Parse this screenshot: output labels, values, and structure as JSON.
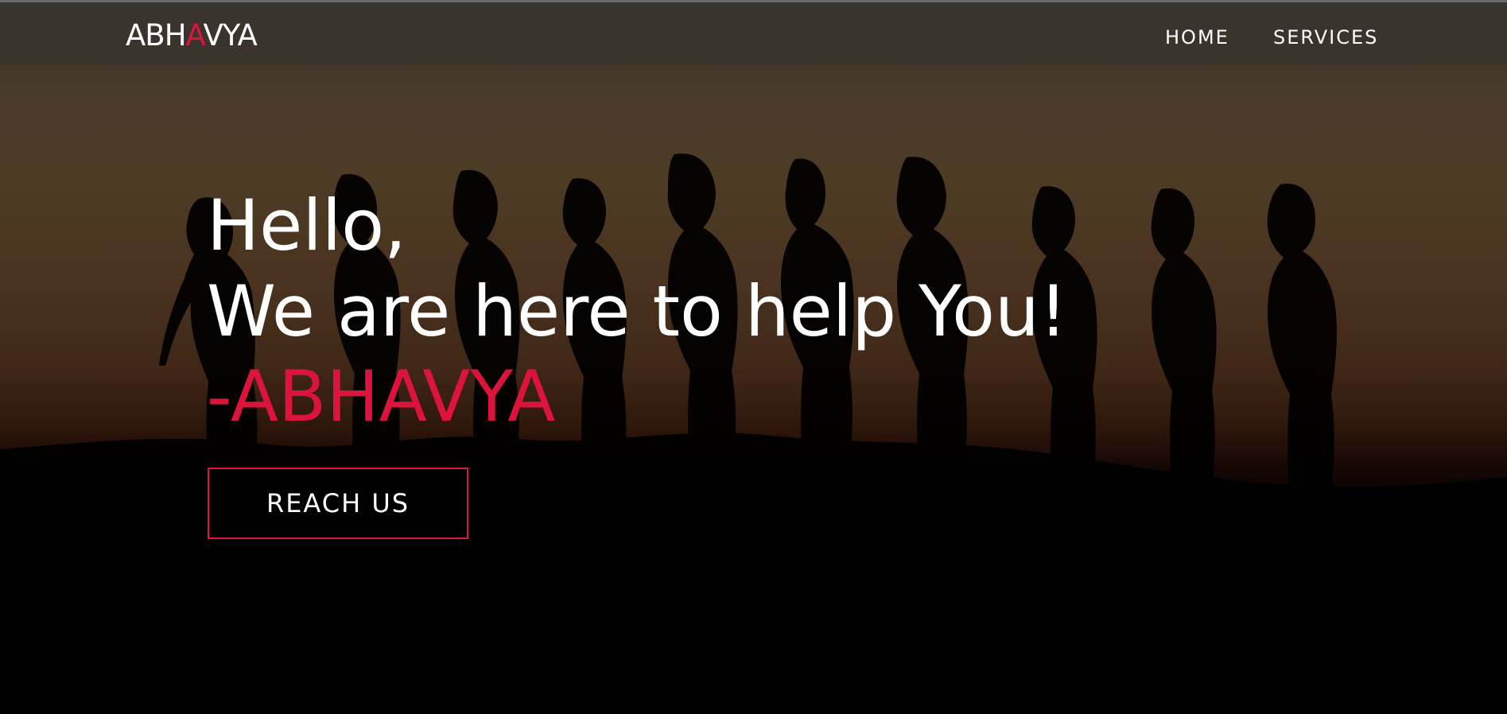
{
  "header": {
    "logo": {
      "part1": "ABH",
      "accent": "A",
      "part2": "VYA"
    },
    "nav": {
      "home": "HOME",
      "services": "SERVICES"
    }
  },
  "hero": {
    "line1": "Hello,",
    "line2": "We are here to help You!",
    "line3": "-ABHAVYA",
    "button": "REACH US",
    "image": "silhouette of women holding hands at sunset"
  },
  "colors": {
    "accent": "#dc143c",
    "text": "#ffffff",
    "nav_bg": "#3a342c",
    "background": "#000000"
  }
}
